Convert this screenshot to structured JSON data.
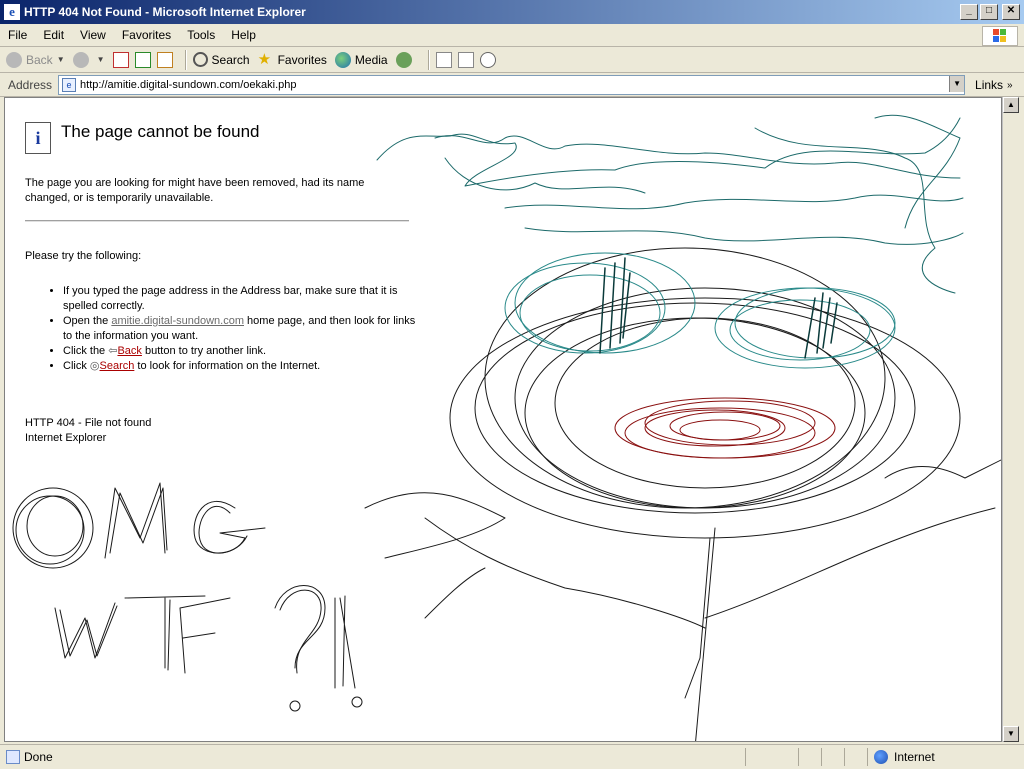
{
  "window": {
    "title": "HTTP 404 Not Found - Microsoft Internet Explorer"
  },
  "menu": [
    "File",
    "Edit",
    "View",
    "Favorites",
    "Tools",
    "Help"
  ],
  "toolbar": {
    "back": "Back",
    "search": "Search",
    "favorites": "Favorites",
    "media": "Media"
  },
  "address": {
    "label": "Address",
    "url": "http://amitie.digital-sundown.com/oekaki.php",
    "links": "Links"
  },
  "page": {
    "title": "The page cannot be found",
    "intro": "The page you are looking for might have been removed, had its name changed, or is temporarily unavailable.",
    "try": "Please try the following:",
    "tip1": "If you typed the page address in the Address bar, make sure that it is spelled correctly.",
    "tip2_pre": "Open the ",
    "tip2_link": "amitie.digital-sundown.com",
    "tip2_post": " home page, and then look for links to the information you want.",
    "tip3_pre": "Click the ",
    "tip3_link": "Back",
    "tip3_post": " button to try another link.",
    "tip4_pre": "Click ",
    "tip4_link": "Search",
    "tip4_post": " to look for information on the Internet.",
    "error1": "HTTP 404 - File not found",
    "error2": "Internet Explorer"
  },
  "status": {
    "text": "Done",
    "zone": "Internet"
  }
}
